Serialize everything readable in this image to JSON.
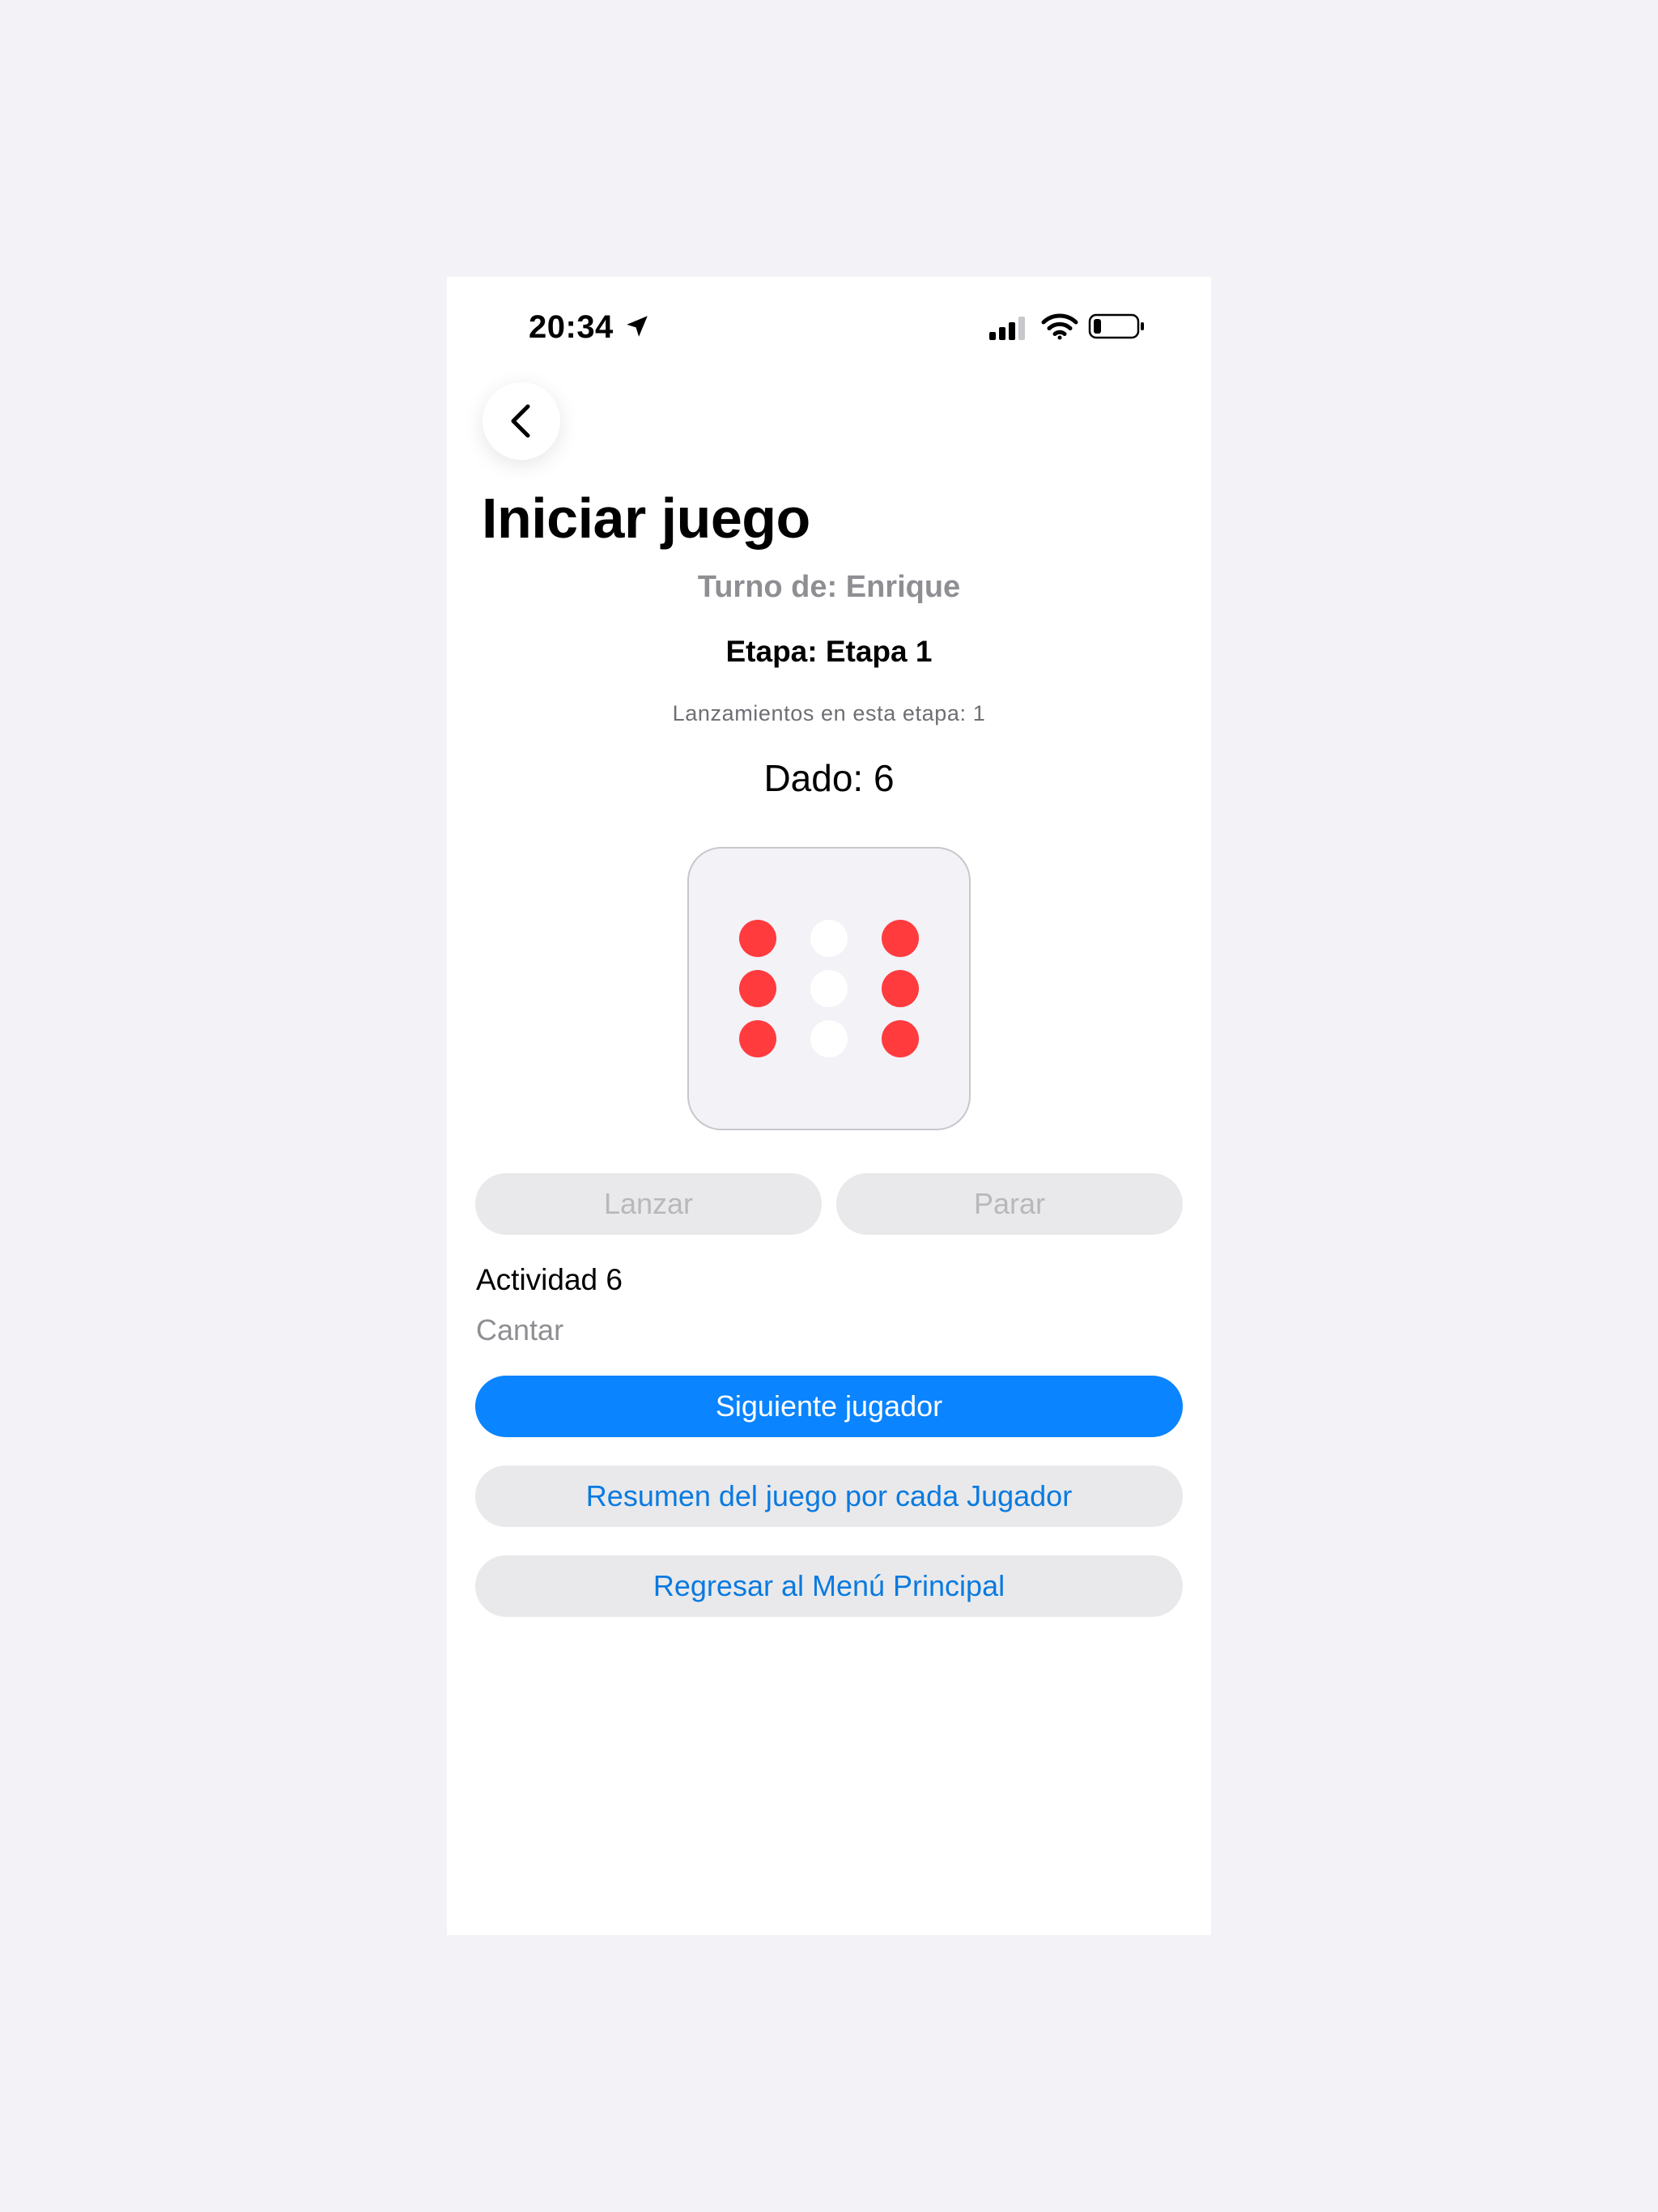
{
  "status_bar": {
    "time": "20:34",
    "location_icon": "location-arrow-icon",
    "signal_icon": "cellular-signal-icon",
    "wifi_icon": "wifi-icon",
    "battery_icon": "battery-low-icon"
  },
  "nav": {
    "back_icon": "chevron-left-icon"
  },
  "page": {
    "title": "Iniciar juego",
    "turn": "Turno de: Enrique",
    "stage": "Etapa: Etapa 1",
    "throws_in_stage": "Lanzamientos en esta etapa: 1",
    "dice_value": "Dado: 6"
  },
  "die": {
    "face_value": 6,
    "pip_color": "#ff3b3e",
    "face_color": "#f2f2f7"
  },
  "controls": {
    "throw_label": "Lanzar",
    "stop_label": "Parar"
  },
  "activity": {
    "title": "Actividad 6",
    "description": "Cantar"
  },
  "actions": {
    "next_player_label": "Siguiente jugador",
    "summary_label": "Resumen del juego por cada Jugador",
    "main_menu_label": "Regresar al Menú Principal"
  },
  "colors": {
    "accent": "#0a84ff",
    "link": "#0a7ae0",
    "disabled_bg": "#e9e9eb"
  }
}
